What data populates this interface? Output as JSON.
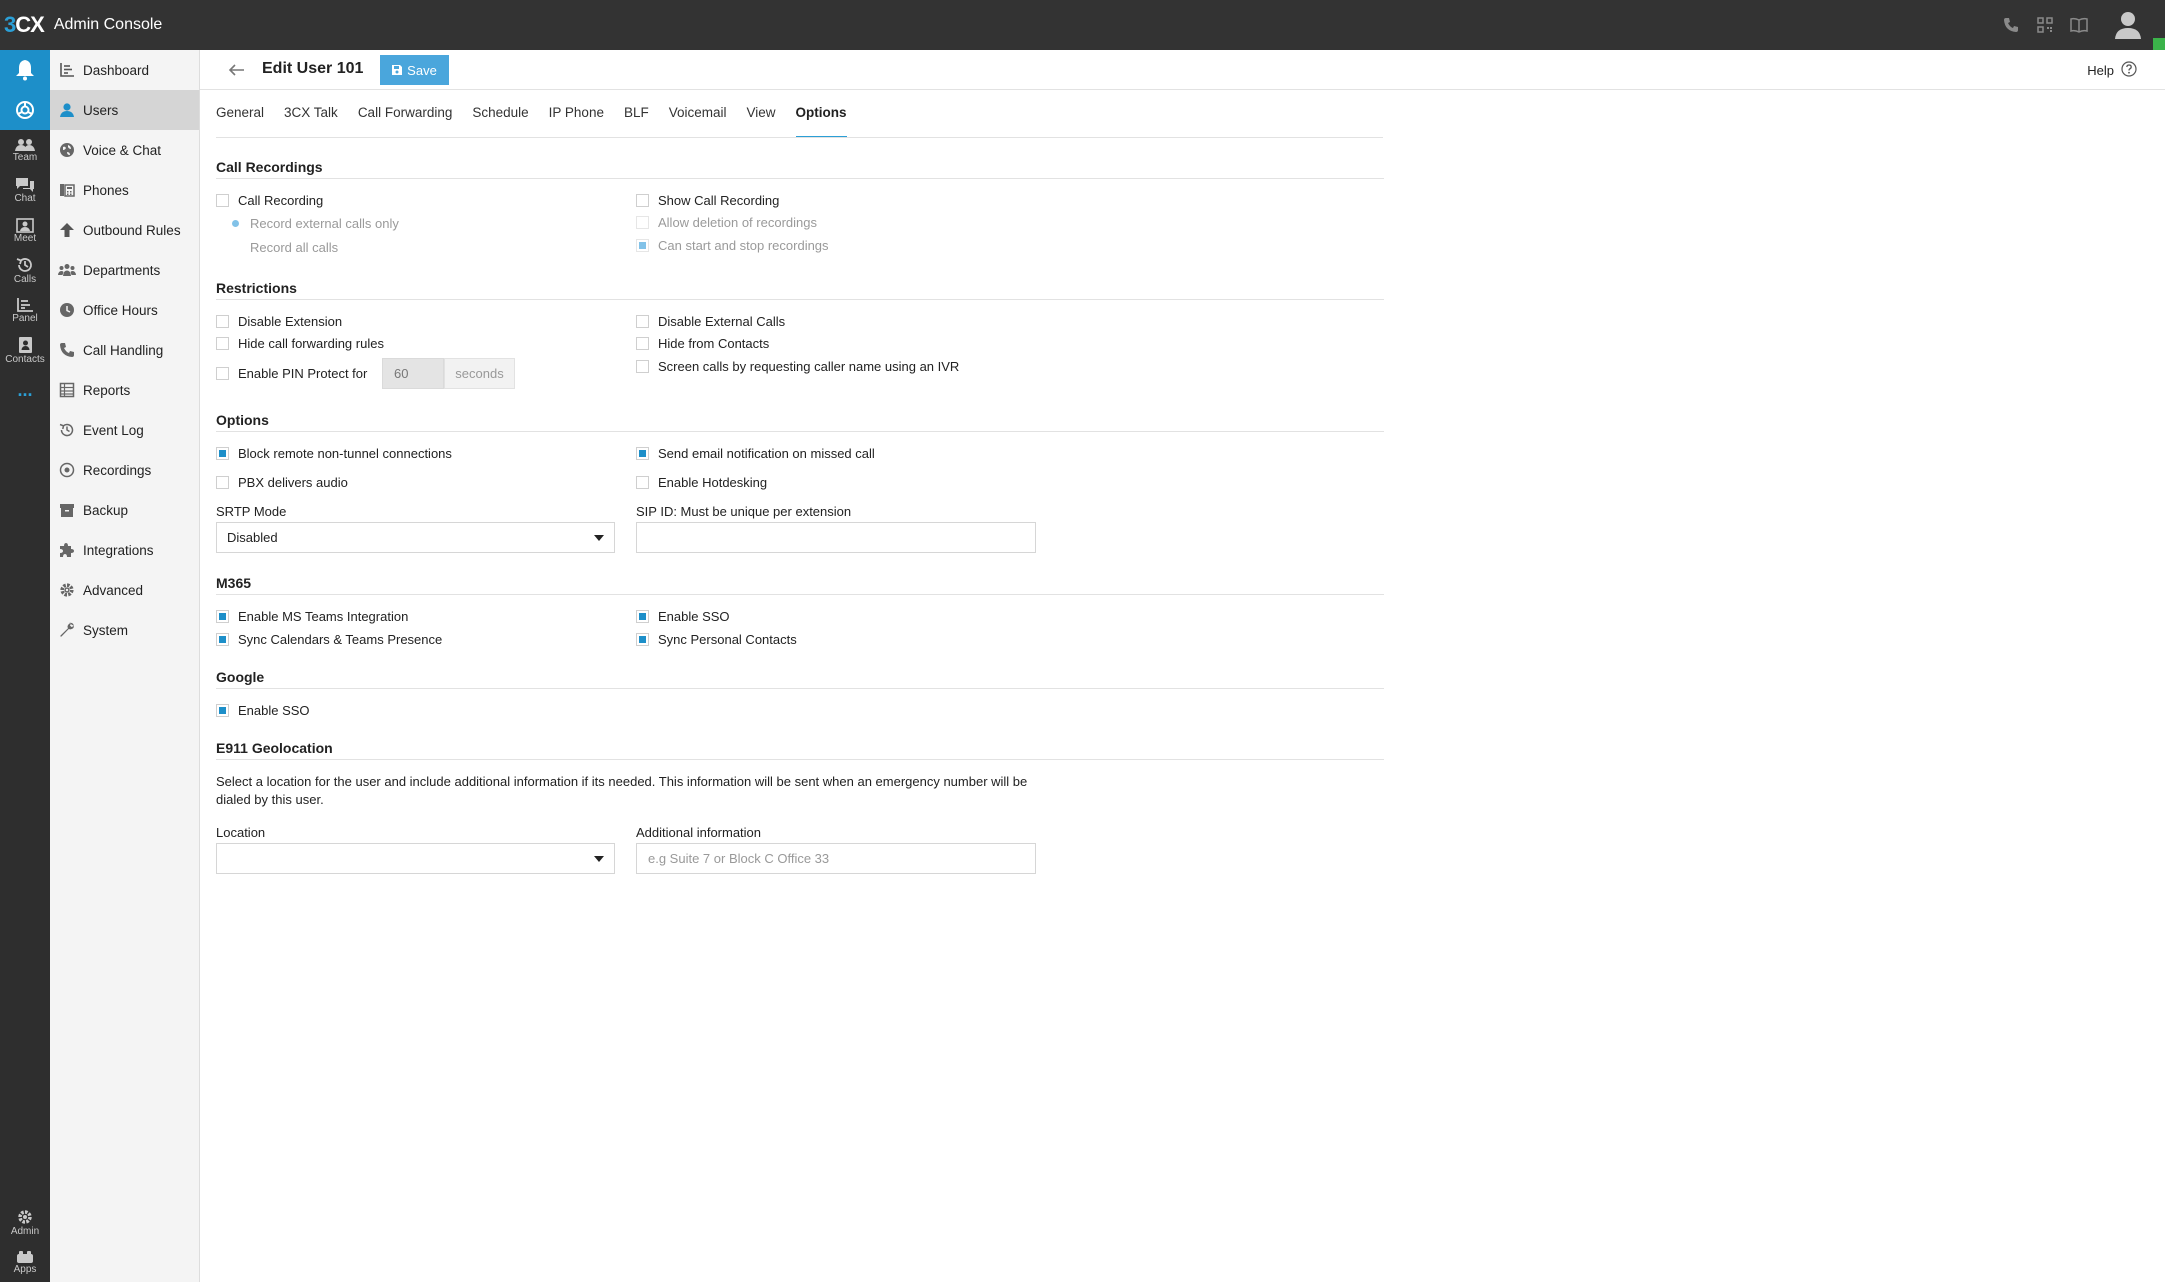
{
  "app": {
    "logo_left": "3",
    "logo_right": "CX",
    "title": "Admin Console"
  },
  "top_icons": [
    "phone-icon",
    "qr-code-icon",
    "book-icon",
    "user-avatar-icon"
  ],
  "rail": {
    "items": [
      {
        "icon": "bell-icon",
        "label": ""
      },
      {
        "icon": "globe-icon",
        "label": ""
      },
      {
        "icon": "team-icon",
        "label": "Team"
      },
      {
        "icon": "chat-icon",
        "label": "Chat"
      },
      {
        "icon": "meet-icon",
        "label": "Meet"
      },
      {
        "icon": "calls-icon",
        "label": "Calls"
      },
      {
        "icon": "panel-icon",
        "label": "Panel"
      },
      {
        "icon": "contacts-icon",
        "label": "Contacts"
      },
      {
        "icon": "more-icon",
        "label": "..."
      }
    ],
    "bottom": [
      {
        "icon": "gear-icon",
        "label": "Admin"
      },
      {
        "icon": "apps-icon",
        "label": "Apps"
      }
    ]
  },
  "nav": {
    "items": [
      {
        "label": "Dashboard",
        "icon": "dashboard-icon"
      },
      {
        "label": "Users",
        "icon": "user-icon",
        "active": true
      },
      {
        "label": "Voice & Chat",
        "icon": "globe-icon"
      },
      {
        "label": "Phones",
        "icon": "phones-icon"
      },
      {
        "label": "Outbound Rules",
        "icon": "arrow-up-icon"
      },
      {
        "label": "Departments",
        "icon": "departments-icon"
      },
      {
        "label": "Office Hours",
        "icon": "clock-icon"
      },
      {
        "label": "Call Handling",
        "icon": "phone-icon"
      },
      {
        "label": "Reports",
        "icon": "reports-icon"
      },
      {
        "label": "Event Log",
        "icon": "history-icon"
      },
      {
        "label": "Recordings",
        "icon": "record-icon"
      },
      {
        "label": "Backup",
        "icon": "archive-icon"
      },
      {
        "label": "Integrations",
        "icon": "puzzle-icon"
      },
      {
        "label": "Advanced",
        "icon": "gear-icon"
      },
      {
        "label": "System",
        "icon": "wrench-icon"
      }
    ]
  },
  "header": {
    "title": "Edit User 101",
    "save_label": "Save",
    "help_label": "Help"
  },
  "tabs": [
    "General",
    "3CX Talk",
    "Call Forwarding",
    "Schedule",
    "IP Phone",
    "BLF",
    "Voicemail",
    "View",
    "Options"
  ],
  "active_tab": "Options",
  "call_recordings": {
    "title": "Call Recordings",
    "call_recording": {
      "label": "Call Recording",
      "checked": false
    },
    "record_external": {
      "label": "Record external calls only",
      "selected": true
    },
    "record_all": {
      "label": "Record all calls",
      "selected": false
    },
    "show_call_recording": {
      "label": "Show Call Recording",
      "checked": false
    },
    "allow_deletion": {
      "label": "Allow deletion of recordings",
      "checked": false
    },
    "can_start_stop": {
      "label": "Can start and stop recordings",
      "checked": true
    }
  },
  "restrictions": {
    "title": "Restrictions",
    "disable_extension": {
      "label": "Disable Extension",
      "checked": false
    },
    "hide_forwarding": {
      "label": "Hide call forwarding rules",
      "checked": false
    },
    "pin_protect": {
      "label": "Enable PIN Protect for",
      "checked": false,
      "value": "60",
      "unit": "seconds"
    },
    "disable_external": {
      "label": "Disable External Calls",
      "checked": false
    },
    "hide_contacts": {
      "label": "Hide from Contacts",
      "checked": false
    },
    "screen_calls": {
      "label": "Screen calls by requesting caller name using an IVR",
      "checked": false
    }
  },
  "options": {
    "title": "Options",
    "block_remote": {
      "label": "Block remote non-tunnel connections",
      "checked": true
    },
    "pbx_audio": {
      "label": "PBX delivers audio",
      "checked": false
    },
    "email_missed": {
      "label": "Send email notification on missed call",
      "checked": true
    },
    "hotdesking": {
      "label": "Enable Hotdesking",
      "checked": false
    },
    "srtp_label": "SRTP Mode",
    "srtp_value": "Disabled",
    "sip_label": "SIP ID: Must be unique per extension",
    "sip_value": ""
  },
  "m365": {
    "title": "M365",
    "ms_teams": {
      "label": "Enable MS Teams Integration",
      "checked": true
    },
    "sync_calendars": {
      "label": "Sync Calendars & Teams Presence",
      "checked": true
    },
    "enable_sso": {
      "label": "Enable SSO",
      "checked": true
    },
    "sync_contacts": {
      "label": "Sync Personal Contacts",
      "checked": true
    }
  },
  "google": {
    "title": "Google",
    "enable_sso": {
      "label": "Enable SSO",
      "checked": true
    }
  },
  "e911": {
    "title": "E911 Geolocation",
    "description_line1": "Select a location for the user and include additional information if its needed. This information will be sent when an emergency number will be",
    "description_line2": "dialed by this user.",
    "location_label": "Location",
    "location_value": "",
    "additional_label": "Additional information",
    "additional_placeholder": "e.g Suite 7 or Block C Office 33"
  },
  "colors": {
    "topbar": "#333333",
    "rail": "#2e2e2e",
    "accent": "#1d8fc9",
    "save_button": "#4aa6dc",
    "status_online": "#3bb34a"
  }
}
